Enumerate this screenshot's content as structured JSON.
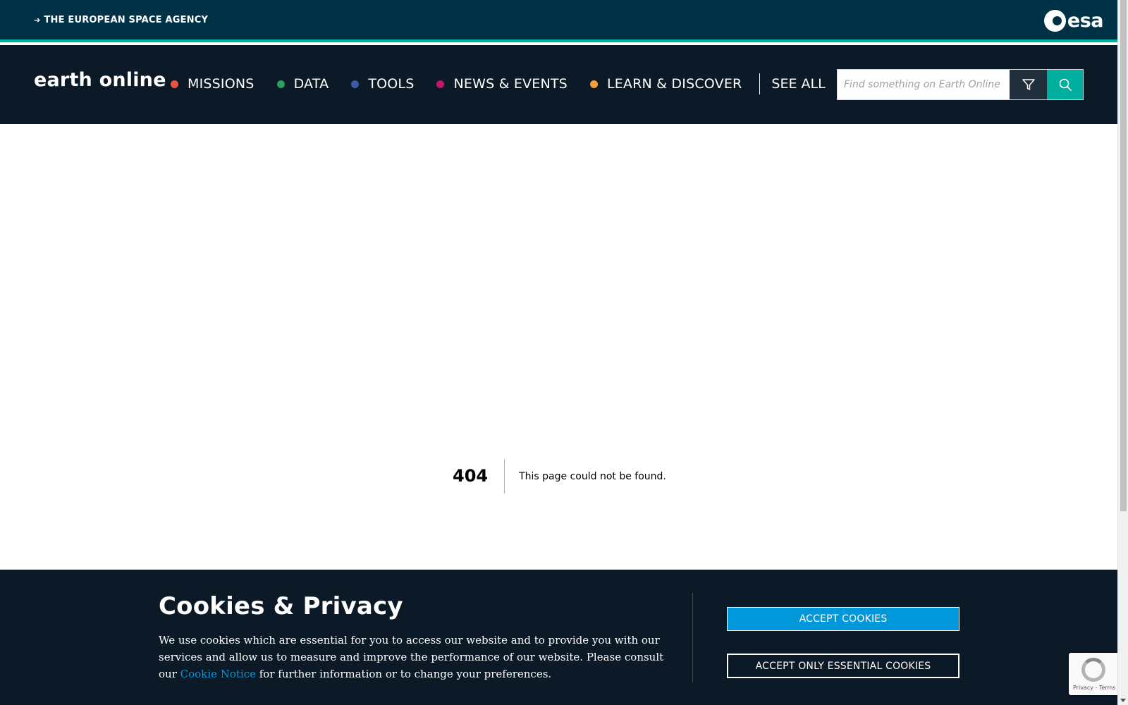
{
  "agency_bar": {
    "link_label": "THE EUROPEAN SPACE AGENCY",
    "logo_text": "esa"
  },
  "nav": {
    "site_title": "earth online",
    "items": [
      {
        "label": "MISSIONS",
        "color": "#e8553e"
      },
      {
        "label": "DATA",
        "color": "#2e9e5b"
      },
      {
        "label": "TOOLS",
        "color": "#3c5aa8"
      },
      {
        "label": "NEWS & EVENTS",
        "color": "#c0176a"
      },
      {
        "label": "LEARN & DISCOVER",
        "color": "#f7a043"
      }
    ],
    "see_all": "SEE ALL",
    "search_placeholder": "Find something on Earth Online",
    "search_value": ""
  },
  "error": {
    "code": "404",
    "message": "This page could not be found."
  },
  "cookies": {
    "title": "Cookies & Privacy",
    "text_before": "We use cookies which are essential for you to access our website and to provide you with our services and allow us to measure and improve the performance of our website. Please consult our ",
    "link_text": "Cookie Notice",
    "text_after": " for further information or to change your preferences.",
    "accept_label": "ACCEPT COOKIES",
    "essential_label": "ACCEPT ONLY ESSENTIAL COOKIES"
  },
  "recaptcha": {
    "links": "Privacy - Terms"
  },
  "colors": {
    "agency_bar": "#003247",
    "nav_bg": "#0b1a26",
    "accent_teal": "#00ae9d",
    "accept_blue": "#0098db"
  }
}
